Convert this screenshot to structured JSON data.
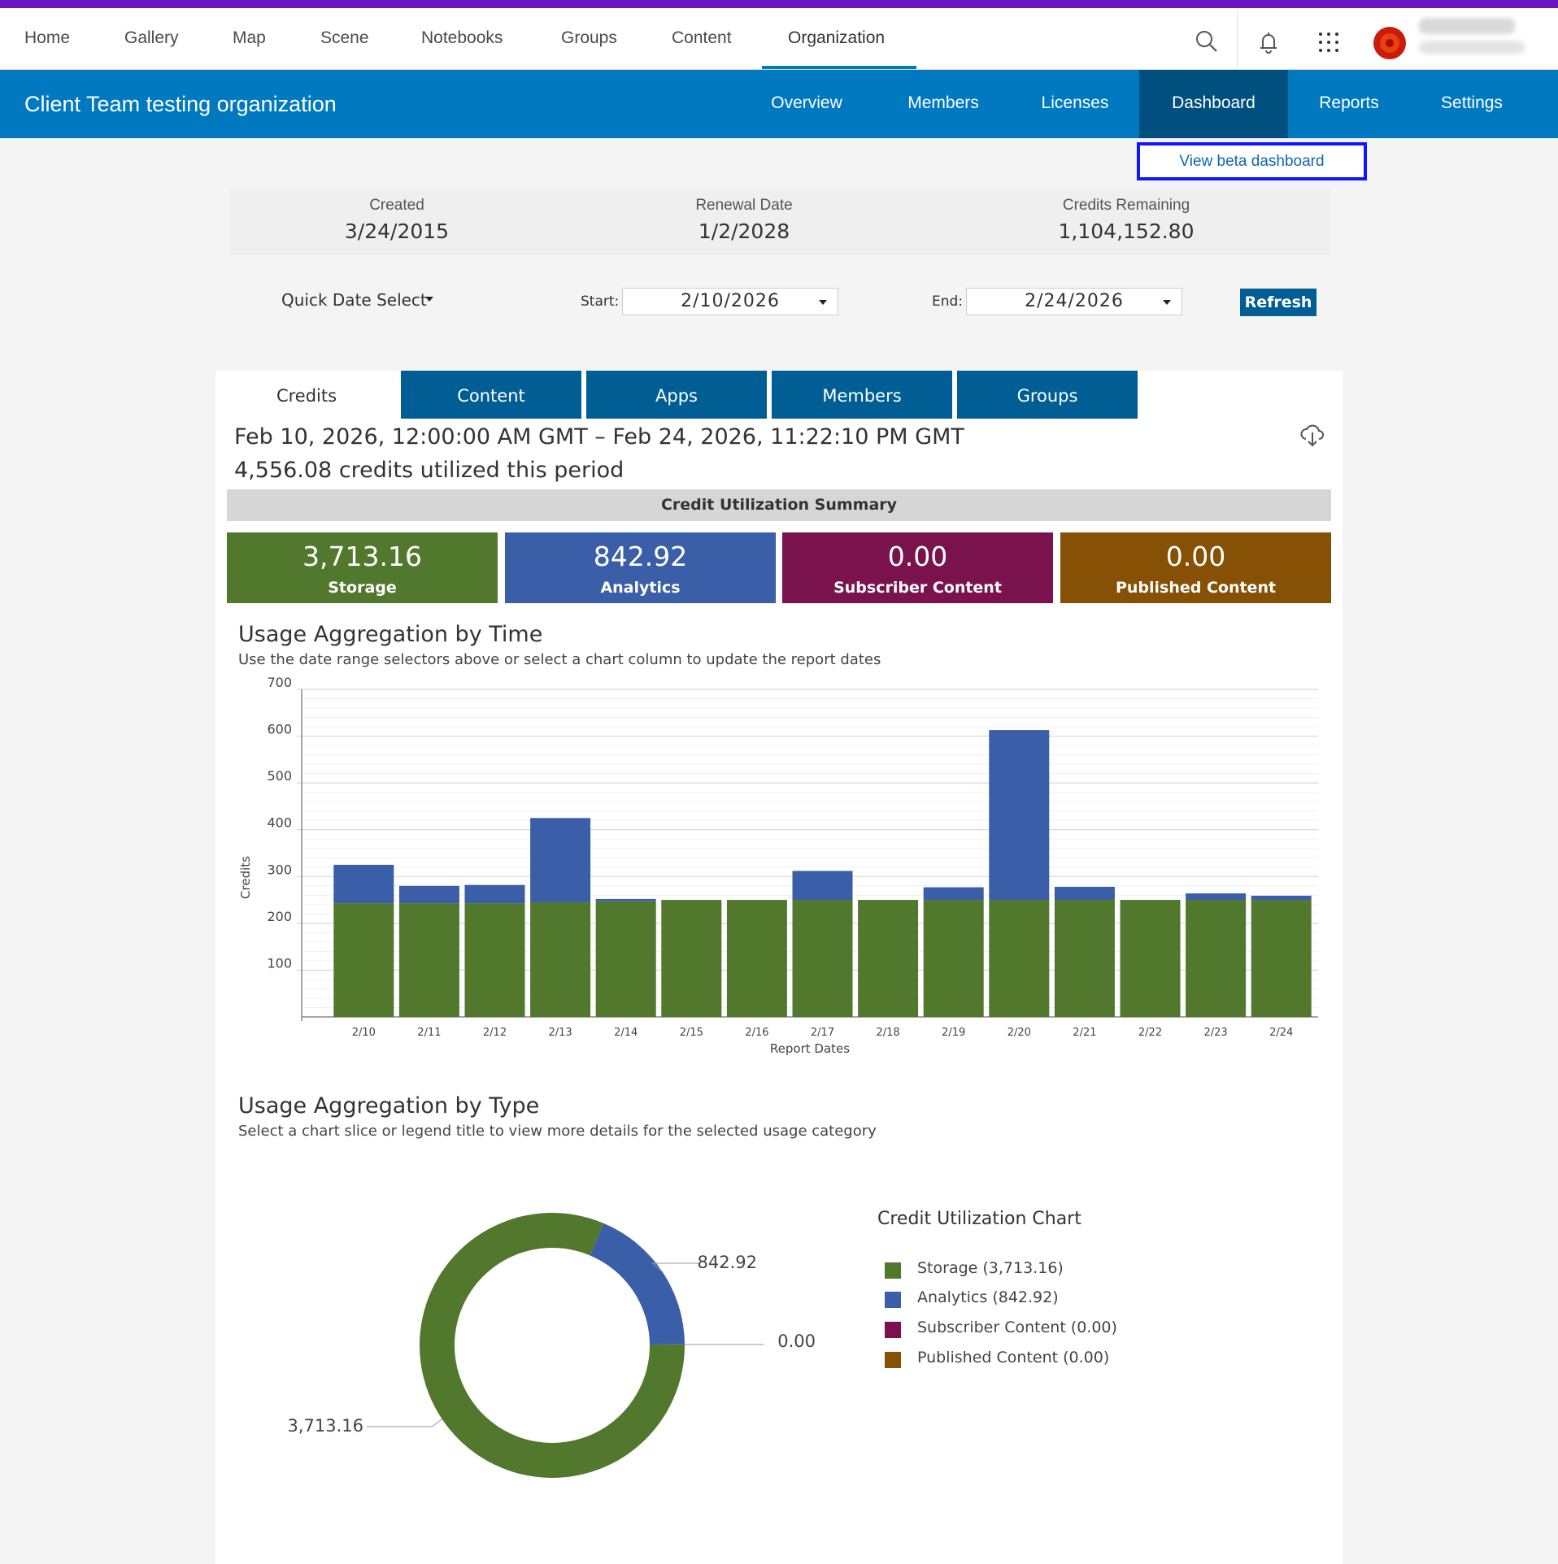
{
  "nav": {
    "items": [
      "Home",
      "Gallery",
      "Map",
      "Scene",
      "Notebooks",
      "Groups",
      "Content",
      "Organization"
    ],
    "active": "Organization"
  },
  "org": {
    "title": "Client Team testing organization",
    "tabs": [
      "Overview",
      "Members",
      "Licenses",
      "Dashboard",
      "Reports",
      "Settings"
    ],
    "active_tab": "Dashboard",
    "beta_link": "View beta dashboard"
  },
  "info": {
    "created_label": "Created",
    "created": "3/24/2015",
    "renewal_label": "Renewal Date",
    "renewal": "1/2/2028",
    "credits_label": "Credits Remaining",
    "credits": "1,104,152.80"
  },
  "controls": {
    "quick_date": "Quick Date Select",
    "start_label": "Start:",
    "start": "2/10/2026",
    "end_label": "End:",
    "end": "2/24/2026",
    "refresh": "Refresh"
  },
  "tabs": [
    "Credits",
    "Content",
    "Apps",
    "Members",
    "Groups"
  ],
  "active_tab": "Credits",
  "period": "Feb 10, 2026, 12:00:00 AM GMT – Feb 24, 2026, 11:22:10 PM GMT",
  "utilized": "4,556.08 credits utilized this period",
  "summary": {
    "title": "Credit Utilization Summary",
    "boxes": [
      {
        "value": "3,713.16",
        "label": "Storage",
        "color": "#52782e"
      },
      {
        "value": "842.92",
        "label": "Analytics",
        "color": "#3b5ea8"
      },
      {
        "value": "0.00",
        "label": "Subscriber Content",
        "color": "#7a134d"
      },
      {
        "value": "0.00",
        "label": "Published Content",
        "color": "#865104"
      }
    ]
  },
  "time_section": {
    "title": "Usage Aggregation by Time",
    "subtitle": "Use the date range selectors above or select a chart column to update the report dates"
  },
  "type_section": {
    "title": "Usage Aggregation by Type",
    "subtitle": "Select a chart slice or legend title to view more details for the selected usage category"
  },
  "legend": {
    "title": "Credit Utilization Chart",
    "items": [
      {
        "label": "Storage (3,713.16)",
        "color": "#52782e"
      },
      {
        "label": "Analytics (842.92)",
        "color": "#3b5ea8"
      },
      {
        "label": "Subscriber Content (0.00)",
        "color": "#7a134d"
      },
      {
        "label": "Published Content (0.00)",
        "color": "#865104"
      }
    ]
  },
  "chart_data": [
    {
      "type": "bar",
      "stacked": true,
      "categories": [
        "2/10",
        "2/11",
        "2/12",
        "2/13",
        "2/14",
        "2/15",
        "2/16",
        "2/17",
        "2/18",
        "2/19",
        "2/20",
        "2/21",
        "2/22",
        "2/23",
        "2/24"
      ],
      "series": [
        {
          "name": "Storage",
          "color": "#52782e",
          "values": [
            243,
            243,
            243,
            245,
            247,
            250,
            250,
            250,
            250,
            250,
            250,
            250,
            250,
            250,
            250
          ]
        },
        {
          "name": "Analytics",
          "color": "#3b5ea8",
          "values": [
            82,
            37,
            39,
            180,
            5,
            0,
            0,
            62,
            0,
            27,
            363,
            28,
            0,
            14,
            9
          ]
        }
      ],
      "xlabel": "Report Dates",
      "ylabel": "Credits",
      "ylim": [
        0,
        700
      ],
      "yticks": [
        100,
        200,
        300,
        400,
        500,
        600,
        700
      ],
      "grid": true
    },
    {
      "type": "pie",
      "donut": true,
      "labels": [
        "Storage",
        "Analytics",
        "Subscriber Content",
        "Published Content"
      ],
      "values": [
        3713.16,
        842.92,
        0.0,
        0.0
      ],
      "value_labels": [
        "3,713.16",
        "842.92",
        "0.00",
        "0.00"
      ],
      "colors": [
        "#52782e",
        "#3b5ea8",
        "#7a134d",
        "#865104"
      ],
      "legend": "right"
    }
  ]
}
